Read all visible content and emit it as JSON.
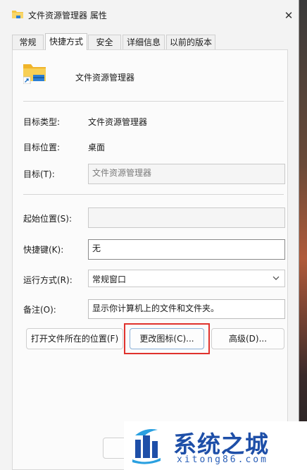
{
  "window": {
    "title": "文件资源管理器 属性",
    "close_symbol": "✕"
  },
  "tabs": [
    {
      "label": "常规"
    },
    {
      "label": "快捷方式"
    },
    {
      "label": "安全"
    },
    {
      "label": "详细信息"
    },
    {
      "label": "以前的版本"
    }
  ],
  "active_tab": "快捷方式",
  "shortcut": {
    "name": "文件资源管理器",
    "target_type_label": "目标类型:",
    "target_type_value": "文件资源管理器",
    "target_location_label": "目标位置:",
    "target_location_value": "桌面",
    "target_label": "目标(T):",
    "target_value": "文件资源管理器",
    "start_in_label": "起始位置(S):",
    "start_in_value": "",
    "hotkey_label": "快捷键(K):",
    "hotkey_value": "无",
    "run_label": "运行方式(R):",
    "run_value": "常规窗口",
    "comment_label": "备注(O):",
    "comment_value": "显示你计算机上的文件和文件夹。"
  },
  "buttons": {
    "open_location": "打开文件所在的位置(F)",
    "change_icon": "更改图标(C)...",
    "advanced": "高级(D)..."
  },
  "watermark": {
    "title": "系统之城",
    "url": "xitong86.com"
  },
  "colors": {
    "highlight": "#e0322d",
    "brand_blue": "#1e4fa8",
    "folder_yellow": "#f4c542"
  }
}
